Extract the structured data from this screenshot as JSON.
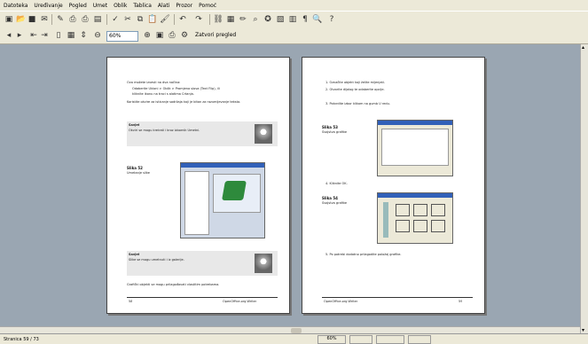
{
  "menubar": {
    "items": [
      "Datoteka",
      "Uređivanje",
      "Pogled",
      "Umet",
      "Oblik",
      "Tablica",
      "Alati",
      "Prozor",
      "Pomoć"
    ]
  },
  "toolbar2": {
    "zoom": "60%",
    "preview_label": "Zatvori pregled"
  },
  "pages": {
    "left": {
      "intro": "Ovo možete izvesti na dva načina:",
      "b1": "Odaberite Ukloni > Oblik > Promjena slova (Text Flip), ili",
      "b2": "kliknite ikonu na traci s alatima Crtanja.",
      "p1": "Koristite okvire za isticanje sadržaja koji je bitan za razumijevanje teksta.",
      "note1_title": "Savjet",
      "note1_text": "Okviri se mogu kreirati i kroz izbornik Umetni.",
      "fig_label": "Slika 52",
      "fig_caption": "Umetanje slike",
      "note2_title": "Savjet",
      "note2_text": "Slike se mogu umetnuti i iz galerije.",
      "p2": "Grafički objekti se mogu prilagođavati vlastitim potrebama.",
      "page_no": "58",
      "footer": "OpenOffice.org Writer"
    },
    "right": {
      "s1": "1. Označite objekt koji želite mijenjati.",
      "s2": "2. Otvorite dijalog te odaberite opcije.",
      "s3": "3. Potvrdite izbor klikom na gumb U redu.",
      "fig1_label": "Slika 53",
      "fig1_caption": "Svojstva grafike",
      "s4": "4. Kliknite OK.",
      "fig2_label": "Slika 54",
      "fig2_caption": "Svojstva grafike",
      "s5": "5. Po potrebi dodatno prilagodite položaj grafike.",
      "page_no": "59",
      "footer": "OpenOffice.org Writer"
    }
  },
  "status": {
    "page": "Stranica 59 / 73",
    "zoom": "60%"
  }
}
